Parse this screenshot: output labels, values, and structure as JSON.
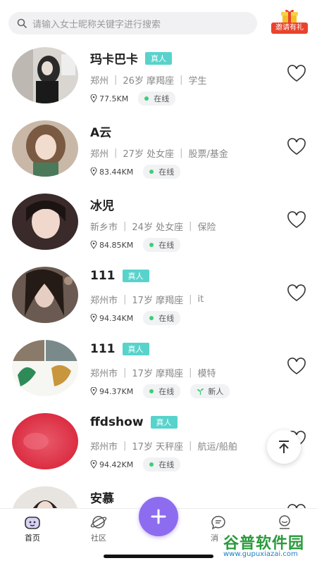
{
  "search": {
    "placeholder": "请输入女士昵称关键字进行搜索"
  },
  "invite": {
    "label": "邀请有礼"
  },
  "users": [
    {
      "name": "玛卡巴卡",
      "verified": "真人",
      "city": "郑州",
      "age": "26岁",
      "zodiac": "摩羯座",
      "job": "学生",
      "distance": "77.5KM",
      "status": "在线"
    },
    {
      "name": "A云",
      "verified": "",
      "city": "郑州",
      "age": "27岁",
      "zodiac": "处女座",
      "job": "股票/基金",
      "distance": "83.44KM",
      "status": "在线"
    },
    {
      "name": "冰児",
      "verified": "",
      "city": "新乡市",
      "age": "24岁",
      "zodiac": "处女座",
      "job": "保险",
      "distance": "84.85KM",
      "status": "在线"
    },
    {
      "name": "111",
      "verified": "真人",
      "city": "郑州市",
      "age": "17岁",
      "zodiac": "摩羯座",
      "job": "it",
      "distance": "94.34KM",
      "status": "在线"
    },
    {
      "name": "111",
      "verified": "真人",
      "city": "郑州市",
      "age": "17岁",
      "zodiac": "摩羯座",
      "job": "模特",
      "distance": "94.37KM",
      "status": "在线",
      "badge": "新人"
    },
    {
      "name": "ffdshow",
      "verified": "真人",
      "city": "郑州市",
      "age": "17岁",
      "zodiac": "天秤座",
      "job": "航运/船舶",
      "distance": "94.42KM",
      "status": "在线"
    },
    {
      "name": "安慕"
    }
  ],
  "tabs": [
    {
      "label": "首页"
    },
    {
      "label": "社区"
    },
    {
      "label": "消息"
    },
    {
      "label": ""
    }
  ],
  "watermark": {
    "title": "谷普软件园",
    "url": "www.gupuxiazai.com"
  },
  "colors": {
    "accent": "#8d6cf0",
    "verified": "#58d3cc",
    "online": "#3ccf7a",
    "invite": "#e8432e"
  }
}
